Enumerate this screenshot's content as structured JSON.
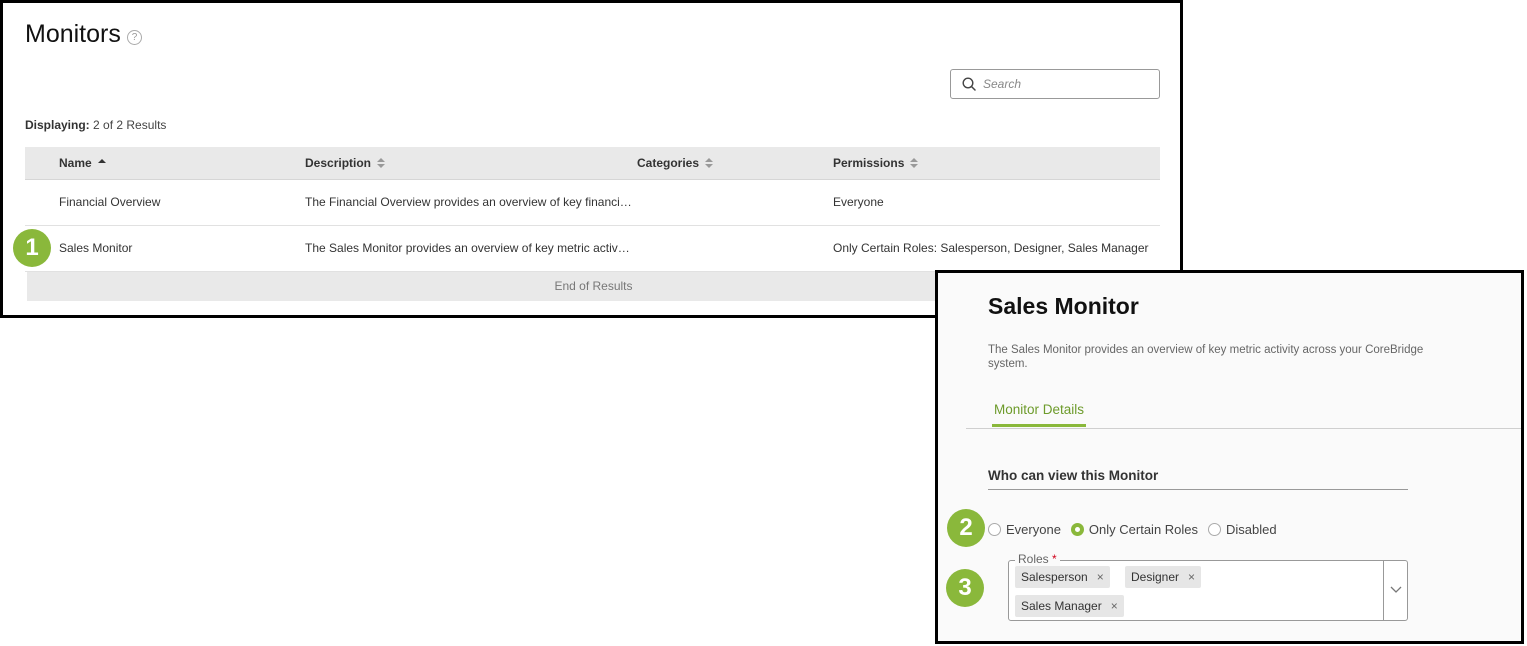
{
  "monitors_list": {
    "title": "Monitors",
    "help_icon": "?",
    "search": {
      "placeholder": "Search",
      "icon": "search-icon"
    },
    "displaying_label": "Displaying:",
    "displaying_value": "2 of 2 Results",
    "columns": [
      {
        "label": "Name",
        "sort": "ascending"
      },
      {
        "label": "Description",
        "sort": "none"
      },
      {
        "label": "Categories",
        "sort": "none"
      },
      {
        "label": "Permissions",
        "sort": "none"
      }
    ],
    "rows": [
      {
        "name": "Financial Overview",
        "description": "The Financial Overview provides an overview of key financi…",
        "categories": "",
        "permissions": "Everyone"
      },
      {
        "name": "Sales Monitor",
        "description": "The Sales Monitor provides an overview of key metric activ…",
        "categories": "",
        "permissions": "Only Certain Roles: Salesperson, Designer, Sales Manager"
      }
    ],
    "end_of_results": "End of Results"
  },
  "monitor_detail": {
    "title": "Sales Monitor",
    "description": "The Sales Monitor provides an overview of key metric activity across your CoreBridge system.",
    "tabs": [
      {
        "label": "Monitor Details",
        "active": true
      }
    ],
    "section_title": "Who can view this Monitor",
    "visibility_options": [
      {
        "label": "Everyone",
        "checked": false
      },
      {
        "label": "Only Certain Roles",
        "checked": true
      },
      {
        "label": "Disabled",
        "checked": false
      }
    ],
    "roles_field": {
      "label": "Roles",
      "required_mark": "*",
      "selected": [
        "Salesperson",
        "Designer",
        "Sales Manager"
      ],
      "remove_glyph": "×"
    }
  },
  "callouts": [
    "1",
    "2",
    "3"
  ],
  "colors": {
    "accent_green": "#8ab83b",
    "tab_green": "#6d9b2b",
    "header_gray": "#e9e9e9",
    "required_red": "#d0021b"
  }
}
